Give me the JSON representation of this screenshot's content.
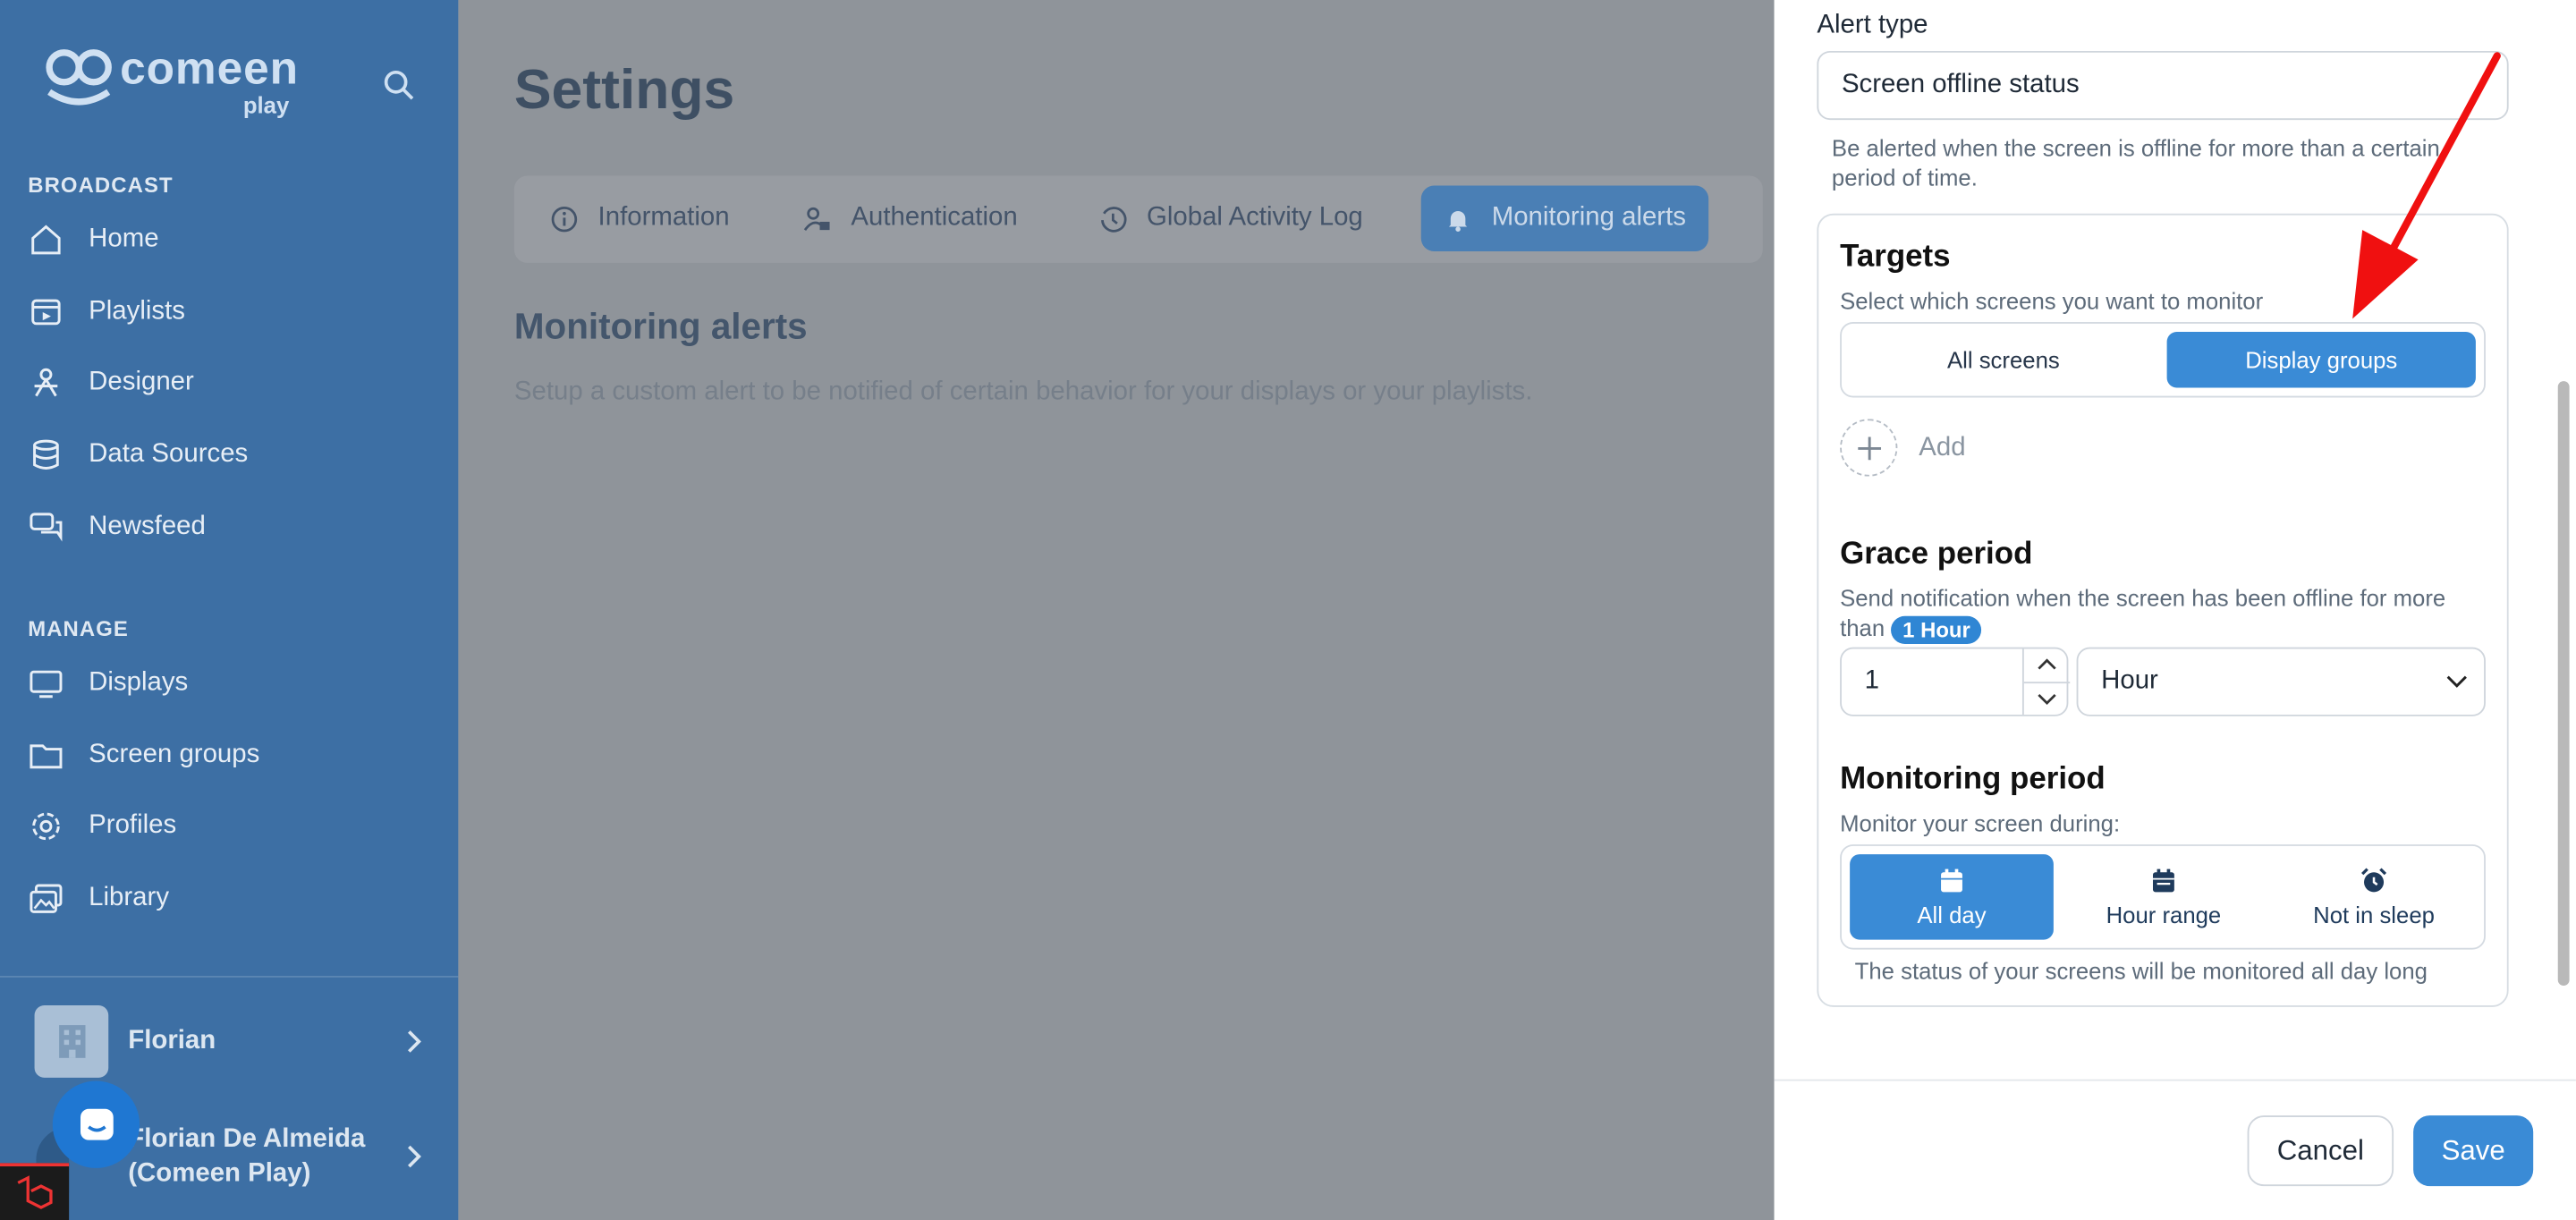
{
  "brand": {
    "name": "comeen",
    "sub": "play"
  },
  "sidebar": {
    "broadcast_heading": "BROADCAST",
    "broadcast_items": [
      {
        "label": "Home",
        "icon": "home-icon"
      },
      {
        "label": "Playlists",
        "icon": "playlist-icon"
      },
      {
        "label": "Designer",
        "icon": "designer-icon"
      },
      {
        "label": "Data Sources",
        "icon": "database-icon"
      },
      {
        "label": "Newsfeed",
        "icon": "chat-icon"
      }
    ],
    "manage_heading": "MANAGE",
    "manage_items": [
      {
        "label": "Displays",
        "icon": "monitor-icon"
      },
      {
        "label": "Screen groups",
        "icon": "folder-icon"
      },
      {
        "label": "Profiles",
        "icon": "gear-icon"
      },
      {
        "label": "Library",
        "icon": "images-icon"
      }
    ],
    "organization": "Florian",
    "user_line1": "Florian De Almeida",
    "user_line2": "(Comeen Play)"
  },
  "main": {
    "title": "Settings",
    "tabs": [
      {
        "label": "Information",
        "icon": "info-icon"
      },
      {
        "label": "Authentication",
        "icon": "user-lock-icon"
      },
      {
        "label": "Global Activity Log",
        "icon": "history-icon"
      },
      {
        "label": "Monitoring alerts",
        "icon": "bell-icon",
        "active": true
      }
    ],
    "section_title": "Monitoring alerts",
    "section_desc": "Setup a custom alert to be notified of certain behavior for your displays or your playlists."
  },
  "drawer": {
    "alert_type_label": "Alert type",
    "alert_type_value": "Screen offline status",
    "alert_type_help": "Be alerted when the screen is offline for more than a certain period of time.",
    "targets": {
      "title": "Targets",
      "help": "Select which screens you want to monitor",
      "options": [
        "All screens",
        "Display groups"
      ],
      "selected": "Display groups",
      "add_label": "Add"
    },
    "grace": {
      "title": "Grace period",
      "help_prefix": "Send notification when the screen has been offline for more than",
      "badge": "1 Hour",
      "value": "1",
      "unit": "Hour"
    },
    "monitoring": {
      "title": "Monitoring period",
      "help": "Monitor your screen during:",
      "options": [
        {
          "label": "All day",
          "icon": "calendar-icon"
        },
        {
          "label": "Hour range",
          "icon": "calendar-range-icon"
        },
        {
          "label": "Not in sleep",
          "icon": "alarm-icon"
        }
      ],
      "selected": "All day",
      "status": "The status of your screens will be monitored all day long"
    },
    "cancel_label": "Cancel",
    "save_label": "Save"
  },
  "colors": {
    "accent": "#3a8bd6",
    "sidebar": "#3d6fa4",
    "overlay": "#8f949a",
    "annotation_arrow": "#f01010"
  }
}
